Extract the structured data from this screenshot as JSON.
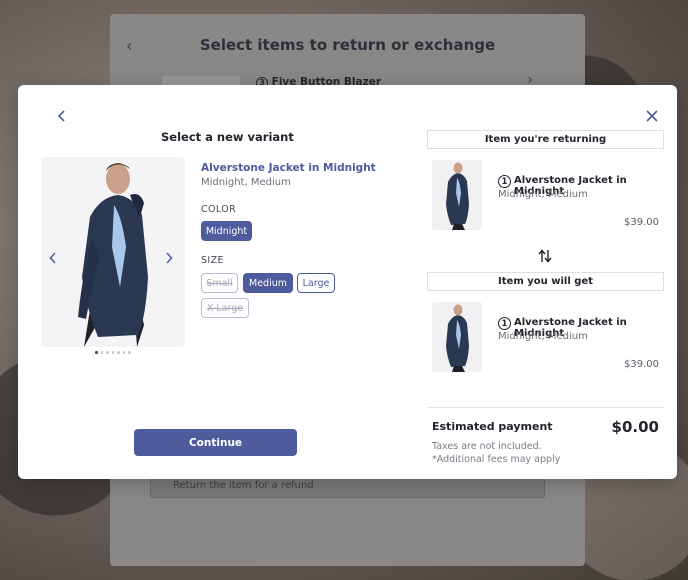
{
  "background": {
    "title": "Select items to return or exchange",
    "item_qty": "3",
    "item_label": "Five Button Blazer",
    "refund_option": "Return the item for a refund"
  },
  "modal": {
    "left": {
      "title": "Select a new variant",
      "variant_name": "Alverstone Jacket in Midnight",
      "variant_sub": "Midnight, Medium",
      "color_label": "COLOR",
      "colors": [
        {
          "label": "Midnight",
          "state": "selected"
        }
      ],
      "size_label": "SIZE",
      "sizes": [
        {
          "label": "Small",
          "state": "disabled"
        },
        {
          "label": "Medium",
          "state": "selected"
        },
        {
          "label": "Large",
          "state": "available"
        },
        {
          "label": "X-Large",
          "state": "disabled"
        }
      ],
      "carousel_dots": 7,
      "carousel_active_dot": 0,
      "continue_label": "Continue"
    },
    "right": {
      "returning_header": "Item you're returning",
      "returning_item": {
        "qty": "1",
        "name": "Alverstone Jacket in Midnight",
        "variant": "Midnight, Medium",
        "price": "$39.00"
      },
      "getting_header": "Item you will get",
      "getting_item": {
        "qty": "1",
        "name": "Alverstone Jacket in Midnight",
        "variant": "Midnight, Medium",
        "price": "$39.00"
      },
      "estimated_label": "Estimated payment",
      "estimated_value": "$0.00",
      "tax_note": "Taxes are not included.",
      "fees_note": "*Additional fees may apply"
    }
  },
  "colors": {
    "accent": "#4e5b9d",
    "text_dark": "#23242c",
    "text_muted": "#6d6e78"
  },
  "icons": [
    "chevron-left-icon",
    "close-icon",
    "chevron-right-icon",
    "swap-vertical-icon"
  ]
}
